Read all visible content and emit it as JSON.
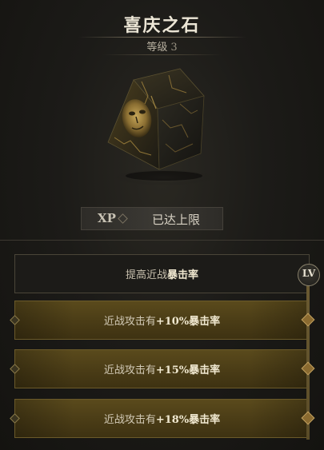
{
  "item": {
    "name": "喜庆之石",
    "level_label": "等级",
    "level_value": "3"
  },
  "xp": {
    "label": "XP",
    "status": "已达上限"
  },
  "upgrades": [
    {
      "prefix": "提高近战",
      "highlight": "暴击率",
      "suffix": "",
      "value": "",
      "unlocked": false
    },
    {
      "prefix": "近战攻击有",
      "value": "+10%",
      "highlight": "暴击率",
      "suffix": "",
      "unlocked": true
    },
    {
      "prefix": "近战攻击有",
      "value": "+15%",
      "highlight": "暴击率",
      "suffix": "",
      "unlocked": true
    },
    {
      "prefix": "近战攻击有",
      "value": "+18%",
      "highlight": "暴击率",
      "suffix": "",
      "unlocked": true
    }
  ],
  "level_track": {
    "badge": "LV"
  },
  "colors": {
    "gold_row": "#4a3c16",
    "accent": "#c0a060",
    "background": "#1a1916"
  }
}
